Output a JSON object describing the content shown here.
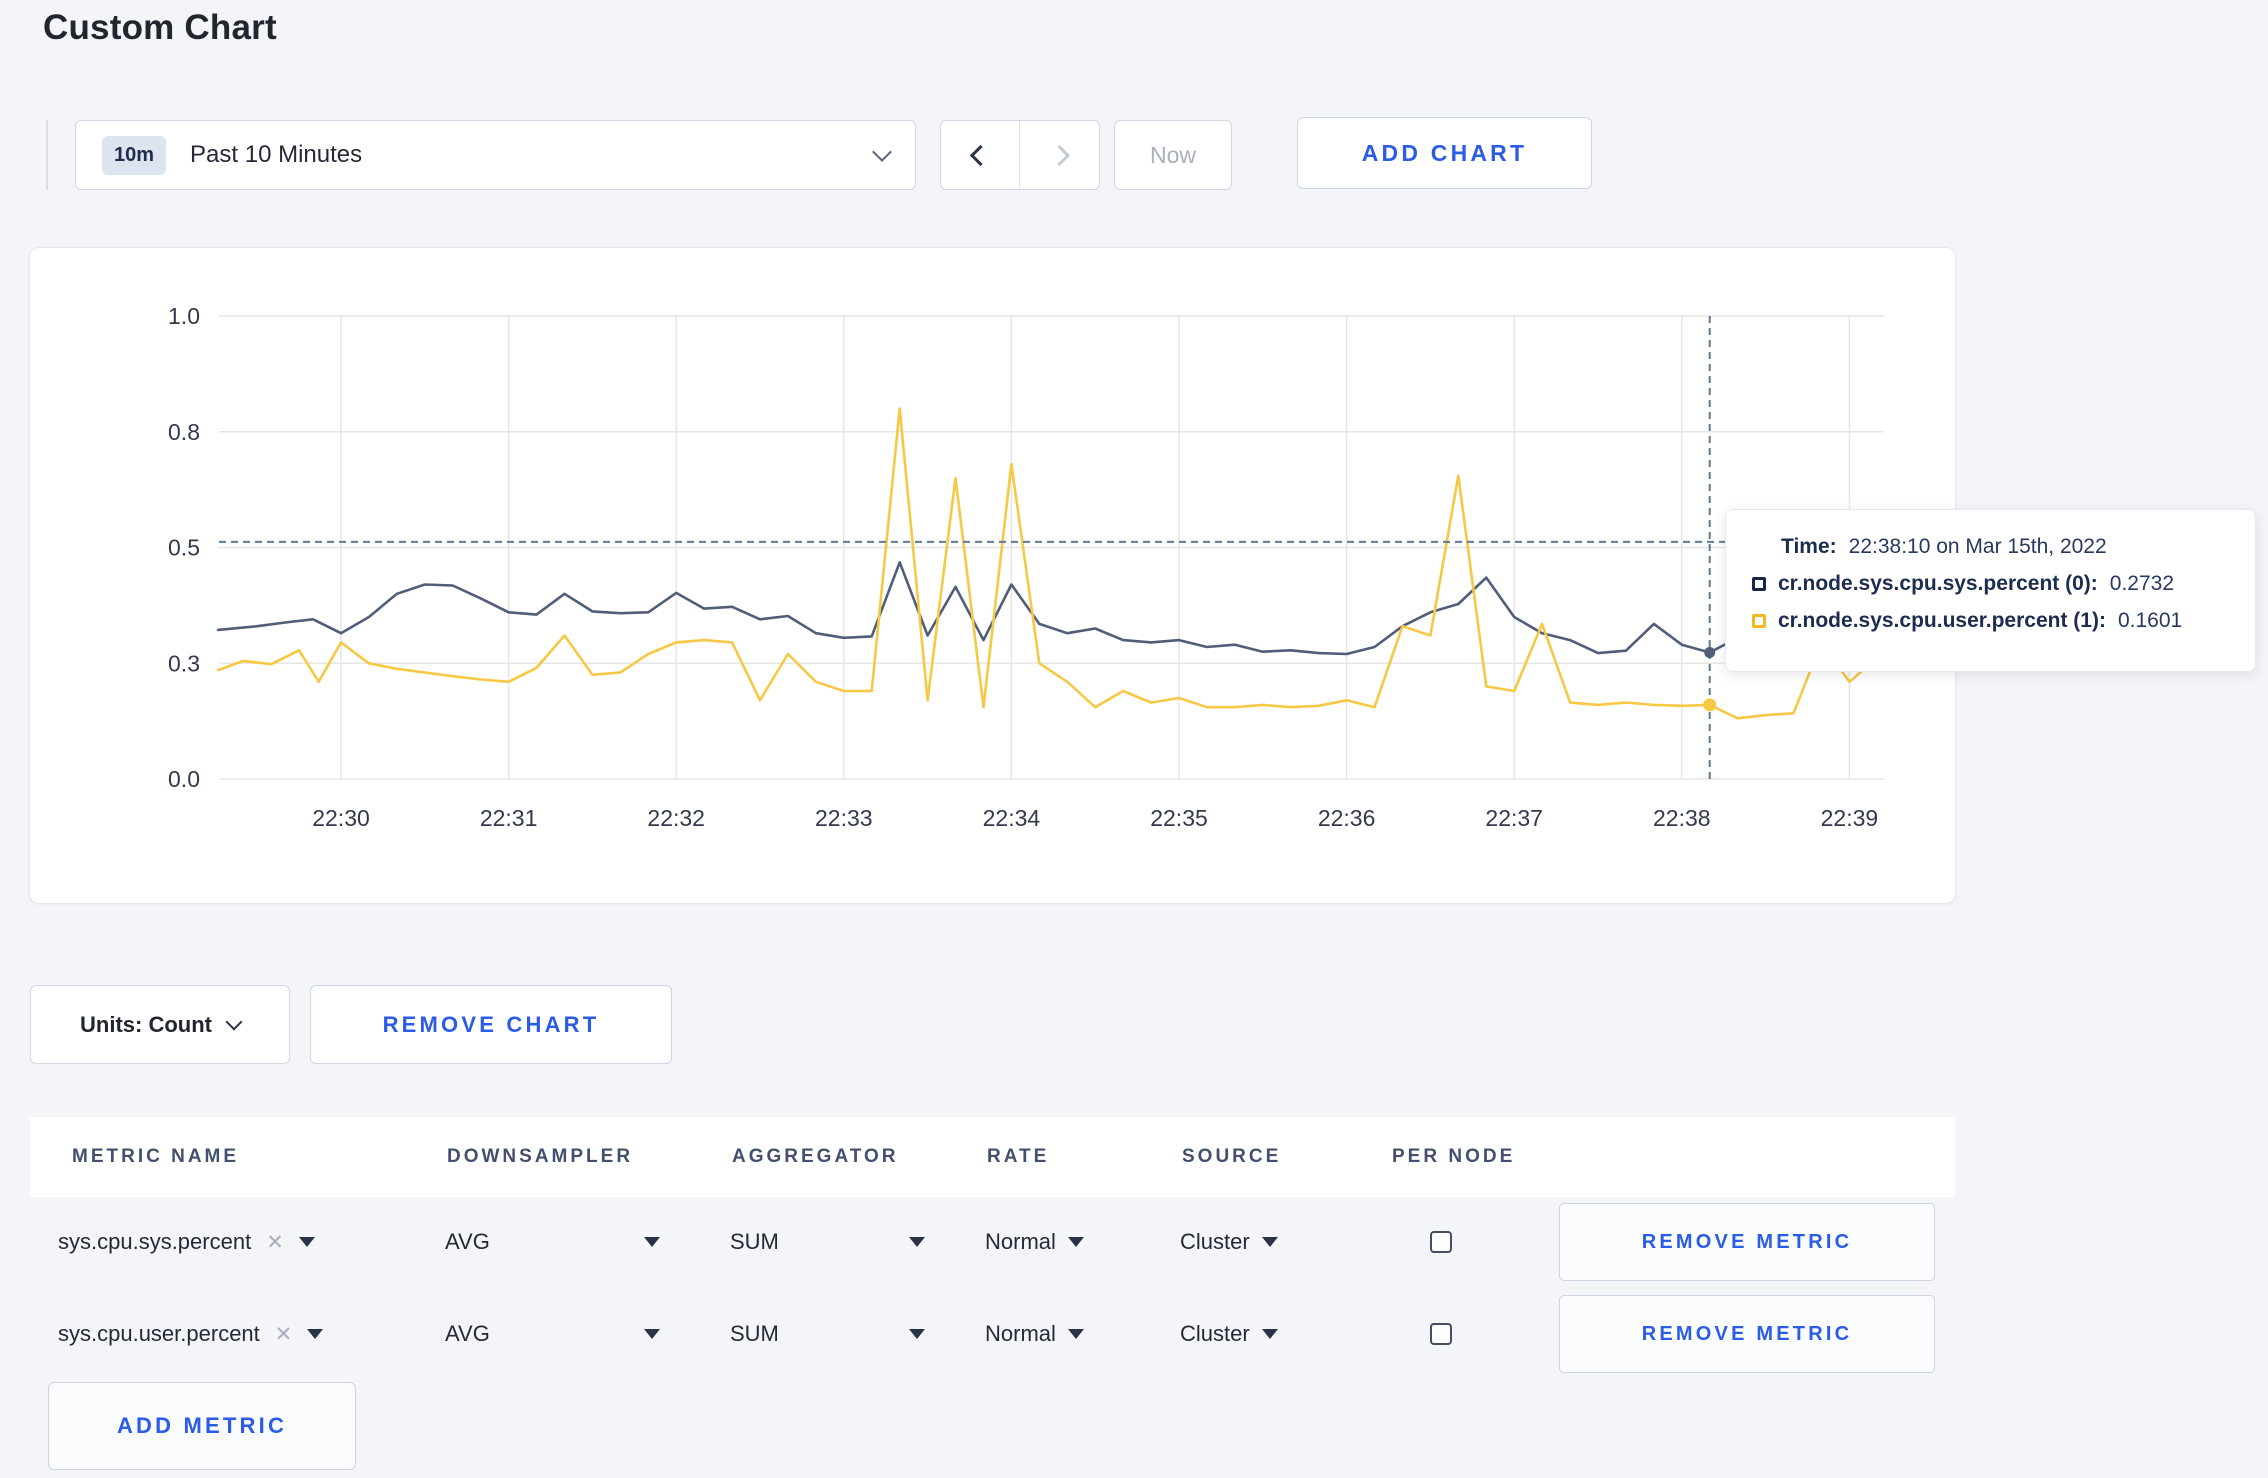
{
  "page": {
    "title": "Custom Chart"
  },
  "toolbar": {
    "time_picker": {
      "badge": "10m",
      "label": "Past 10 Minutes"
    },
    "now_label": "Now",
    "add_chart_label": "ADD CHART"
  },
  "chart_data": {
    "type": "line",
    "title": "",
    "xlabel": "",
    "ylabel": "",
    "x_axis": {
      "ticks": [
        "22:30",
        "22:31",
        "22:32",
        "22:33",
        "22:34",
        "22:35",
        "22:36",
        "22:37",
        "22:38",
        "22:39"
      ],
      "window_seconds": [
        -44,
        552
      ]
    },
    "y_axis": {
      "range": [
        0,
        1
      ],
      "tick_values": [
        0,
        0.25,
        0.5,
        0.75,
        1
      ],
      "tick_labels": [
        "0.0",
        "0.3",
        "0.5",
        "0.8",
        "1.0"
      ]
    },
    "grid": true,
    "series": [
      {
        "name": "cr.node.sys.cpu.sys.percent (0)",
        "color": "#505e78",
        "points": [
          [
            -44,
            0.322
          ],
          [
            -30,
            0.33
          ],
          [
            -20,
            0.338
          ],
          [
            -10,
            0.345
          ],
          [
            0,
            0.315
          ],
          [
            10,
            0.35
          ],
          [
            20,
            0.4
          ],
          [
            30,
            0.42
          ],
          [
            40,
            0.418
          ],
          [
            50,
            0.39
          ],
          [
            60,
            0.36
          ],
          [
            70,
            0.355
          ],
          [
            80,
            0.4
          ],
          [
            90,
            0.362
          ],
          [
            100,
            0.358
          ],
          [
            110,
            0.36
          ],
          [
            120,
            0.402
          ],
          [
            130,
            0.368
          ],
          [
            140,
            0.372
          ],
          [
            150,
            0.345
          ],
          [
            160,
            0.352
          ],
          [
            170,
            0.315
          ],
          [
            180,
            0.305
          ],
          [
            190,
            0.308
          ],
          [
            200,
            0.468
          ],
          [
            210,
            0.31
          ],
          [
            220,
            0.415
          ],
          [
            230,
            0.3
          ],
          [
            240,
            0.42
          ],
          [
            250,
            0.335
          ],
          [
            260,
            0.315
          ],
          [
            270,
            0.325
          ],
          [
            280,
            0.3
          ],
          [
            290,
            0.295
          ],
          [
            300,
            0.3
          ],
          [
            310,
            0.285
          ],
          [
            320,
            0.29
          ],
          [
            330,
            0.275
          ],
          [
            340,
            0.278
          ],
          [
            350,
            0.272
          ],
          [
            360,
            0.27
          ],
          [
            370,
            0.285
          ],
          [
            380,
            0.33
          ],
          [
            390,
            0.36
          ],
          [
            400,
            0.378
          ],
          [
            410,
            0.435
          ],
          [
            420,
            0.35
          ],
          [
            430,
            0.315
          ],
          [
            440,
            0.3
          ],
          [
            450,
            0.272
          ],
          [
            460,
            0.277
          ],
          [
            470,
            0.335
          ],
          [
            480,
            0.29
          ],
          [
            490,
            0.2732
          ],
          [
            500,
            0.305
          ],
          [
            510,
            0.298
          ],
          [
            520,
            0.3
          ],
          [
            530,
            0.295
          ],
          [
            540,
            0.3
          ],
          [
            552,
            0.298
          ]
        ]
      },
      {
        "name": "cr.node.sys.cpu.user.percent (1)",
        "color": "#f6c844",
        "points": [
          [
            -44,
            0.235
          ],
          [
            -35,
            0.255
          ],
          [
            -25,
            0.248
          ],
          [
            -15,
            0.278
          ],
          [
            -8,
            0.21
          ],
          [
            0,
            0.295
          ],
          [
            10,
            0.25
          ],
          [
            20,
            0.238
          ],
          [
            30,
            0.23
          ],
          [
            40,
            0.222
          ],
          [
            50,
            0.215
          ],
          [
            60,
            0.21
          ],
          [
            70,
            0.24
          ],
          [
            80,
            0.31
          ],
          [
            90,
            0.225
          ],
          [
            100,
            0.23
          ],
          [
            110,
            0.27
          ],
          [
            120,
            0.295
          ],
          [
            130,
            0.3
          ],
          [
            140,
            0.295
          ],
          [
            150,
            0.17
          ],
          [
            160,
            0.27
          ],
          [
            170,
            0.21
          ],
          [
            180,
            0.19
          ],
          [
            190,
            0.19
          ],
          [
            200,
            0.8
          ],
          [
            210,
            0.17
          ],
          [
            220,
            0.65
          ],
          [
            230,
            0.155
          ],
          [
            240,
            0.68
          ],
          [
            250,
            0.25
          ],
          [
            260,
            0.21
          ],
          [
            270,
            0.155
          ],
          [
            280,
            0.19
          ],
          [
            290,
            0.165
          ],
          [
            300,
            0.175
          ],
          [
            310,
            0.155
          ],
          [
            320,
            0.155
          ],
          [
            330,
            0.16
          ],
          [
            340,
            0.155
          ],
          [
            350,
            0.158
          ],
          [
            360,
            0.17
          ],
          [
            370,
            0.155
          ],
          [
            380,
            0.33
          ],
          [
            390,
            0.31
          ],
          [
            400,
            0.655
          ],
          [
            410,
            0.2
          ],
          [
            420,
            0.19
          ],
          [
            430,
            0.335
          ],
          [
            440,
            0.165
          ],
          [
            450,
            0.16
          ],
          [
            460,
            0.165
          ],
          [
            470,
            0.16
          ],
          [
            480,
            0.158
          ],
          [
            490,
            0.1601
          ],
          [
            500,
            0.131
          ],
          [
            510,
            0.138
          ],
          [
            520,
            0.142
          ],
          [
            530,
            0.295
          ],
          [
            540,
            0.21
          ],
          [
            552,
            0.272
          ]
        ]
      }
    ],
    "crosshair": {
      "t_seconds": 490,
      "hline_value": 0.512,
      "color": "#5e7a94",
      "marker_values": [
        0.2732,
        0.1601
      ]
    },
    "legend_position": "tooltip",
    "colors": {
      "grid": "#e6e6e6",
      "tick_text": "#33394a"
    }
  },
  "tooltip": {
    "time_label": "Time:",
    "time_value": "22:38:10 on Mar 15th, 2022",
    "rows": [
      {
        "label": "cr.node.sys.cpu.sys.percent (0):",
        "value": "0.2732",
        "color": "#16284a"
      },
      {
        "label": "cr.node.sys.cpu.user.percent (1):",
        "value": "0.1601",
        "color": "#f1bb1f"
      }
    ]
  },
  "units": {
    "label": "Units: Count"
  },
  "remove_chart_label": "REMOVE CHART",
  "metrics_table": {
    "columns": [
      "METRIC NAME",
      "DOWNSAMPLER",
      "AGGREGATOR",
      "RATE",
      "SOURCE",
      "PER NODE"
    ],
    "rows": [
      {
        "metric_name": "sys.cpu.sys.percent",
        "downsampler": "AVG",
        "aggregator": "SUM",
        "rate": "Normal",
        "source": "Cluster",
        "per_node_checked": false,
        "remove_label": "REMOVE METRIC"
      },
      {
        "metric_name": "sys.cpu.user.percent",
        "downsampler": "AVG",
        "aggregator": "SUM",
        "rate": "Normal",
        "source": "Cluster",
        "per_node_checked": false,
        "remove_label": "REMOVE METRIC"
      }
    ],
    "add_metric_label": "ADD METRIC"
  },
  "colors": {
    "accent_blue": "#2b5ce6",
    "background": "#f4f5f9",
    "text_dark": "#242a35",
    "muted_text": "#a7aebc"
  }
}
